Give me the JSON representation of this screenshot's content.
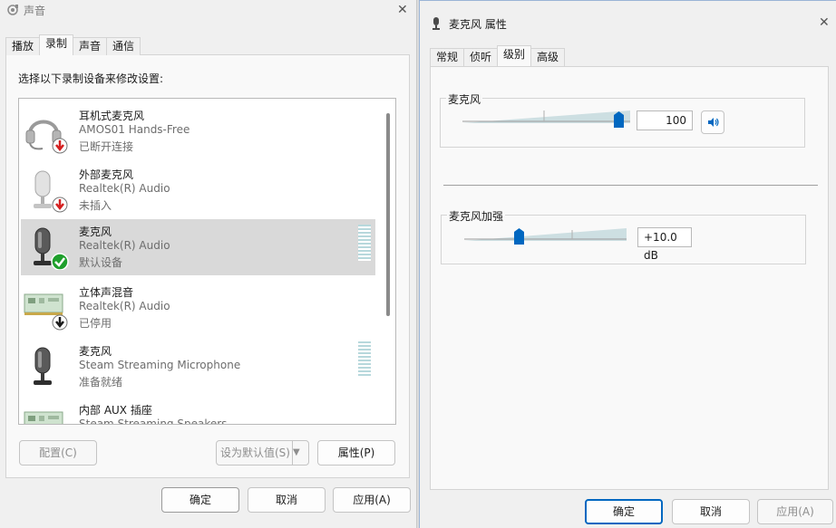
{
  "sound_window": {
    "title": "声音",
    "tabs": [
      "播放",
      "录制",
      "声音",
      "通信"
    ],
    "active_tab": "录制",
    "instruction": "选择以下录制设备来修改设置:",
    "devices": [
      {
        "name": "耳机式麦克风",
        "description": "AMOS01 Hands-Free",
        "status": "已断开连接",
        "icon": "headset-microphone-icon",
        "badge": "red-down-arrow-icon"
      },
      {
        "name": "外部麦克风",
        "description": "Realtek(R) Audio",
        "status": "未插入",
        "icon": "microphone-icon",
        "badge": "red-down-arrow-icon"
      },
      {
        "name": "麦克风",
        "description": "Realtek(R) Audio",
        "status": "默认设备",
        "icon": "microphone-icon",
        "badge": "green-check-icon"
      },
      {
        "name": "立体声混音",
        "description": "Realtek(R) Audio",
        "status": "已停用",
        "icon": "sound-card-icon",
        "badge": "black-down-arrow-icon"
      },
      {
        "name": "麦克风",
        "description": "Steam Streaming Microphone",
        "status": "准备就绪",
        "icon": "microphone-icon",
        "badge": ""
      },
      {
        "name": "内部 AUX 插座",
        "description": "Steam Streaming Speakers",
        "status": "",
        "icon": "sound-card-icon",
        "badge": ""
      }
    ],
    "selected_device_index": 2,
    "buttons": {
      "configure": "配置(C)",
      "set_default": "设为默认值(S)",
      "properties": "属性(P)",
      "ok": "确定",
      "cancel": "取消",
      "apply": "应用(A)"
    }
  },
  "properties_window": {
    "title": "麦克风 属性",
    "tabs": [
      "常规",
      "侦听",
      "级别",
      "高级"
    ],
    "active_tab": "级别",
    "microphone": {
      "label": "麦克风",
      "value": "100",
      "level_fraction": 1.0
    },
    "boost": {
      "label": "麦克风加强",
      "value": "+10.0 dB",
      "level_fraction": 0.33
    },
    "buttons": {
      "ok": "确定",
      "cancel": "取消",
      "apply": "应用(A)"
    }
  },
  "colors": {
    "accent": "#0067c0",
    "selected_row": "#d9d9d9",
    "error_badge": "#d42020",
    "ok_badge": "#1f9f2c"
  }
}
